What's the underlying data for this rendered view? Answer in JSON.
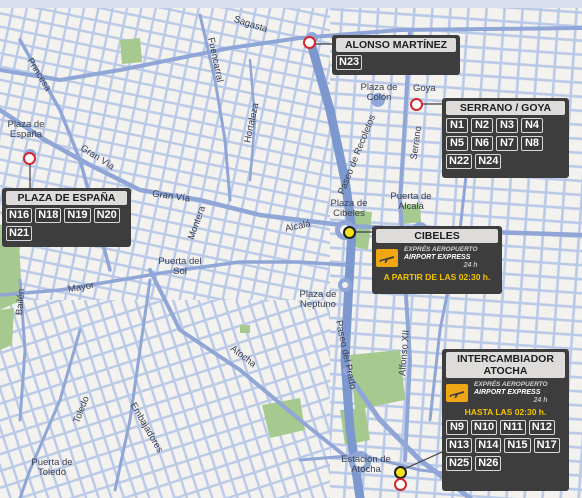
{
  "map": {
    "places": {
      "sagasta": "Sagasta",
      "goya": "Goya",
      "plaza_colon": "Plaza de Colón",
      "princesa": "Princesa",
      "fuencarral": "Fuencarral",
      "hortaleza": "Hortaleza",
      "plaza_espana": "Plaza de España",
      "gran_via_1": "Gran Vía",
      "gran_via_2": "Gran Vía",
      "paseo_recoletos": "Paseo de Recoletos",
      "serrano": "Serrano",
      "plaza_cibeles": "Plaza de Cibeles",
      "puerta_alcala": "Puerta de Alcalá",
      "alcala": "Alcalá",
      "montera": "Montera",
      "puerta_sol": "Puerta del Sol",
      "mayor": "Mayor",
      "bailen": "Bailén",
      "plaza_neptuno": "Plaza de Neptuno",
      "paseo_prado": "Paseo del Prado",
      "alfonso_xii": "Alfonso XII",
      "atocha": "Atocha",
      "toledo": "Toledo",
      "embajadores": "Embajadores",
      "puerta_toledo": "Puerta de Toledo",
      "estacion_atocha": "Estación de Atocha"
    },
    "colors": {
      "block": "#f4f2ee",
      "street_light": "#b9c9e8",
      "street_main": "#8fa6d6",
      "park": "#a5c98e",
      "stop_red": "#d3272b",
      "stop_yellow": "#f5e21a",
      "panel": "#3d3d3e",
      "accent": "#f5c400"
    }
  },
  "panels": {
    "alonso": {
      "title": "ALONSO MARTÍNEZ",
      "codes": [
        "N23"
      ]
    },
    "serrano": {
      "title": "SERRANO / GOYA",
      "codes": [
        "N1",
        "N2",
        "N3",
        "N4",
        "N5",
        "N6",
        "N7",
        "N8",
        "N22",
        "N24"
      ]
    },
    "espana": {
      "title": "PLAZA DE ESPAÑA",
      "codes": [
        "N16",
        "N18",
        "N19",
        "N20",
        "N21"
      ]
    },
    "cibeles": {
      "title": "CIBELES",
      "brand_top": "EXPRÉS AEROPUERTO",
      "brand_main": "AIRPORT EXPRESS",
      "brand_24": "24 h",
      "note": "A PARTIR DE LAS 02:30 h."
    },
    "atocha": {
      "title_1": "INTERCAMBIADOR",
      "title_2": "ATOCHA",
      "brand_top": "EXPRÉS AEROPUERTO",
      "brand_main": "AIRPORT EXPRESS",
      "brand_24": "24 h",
      "note": "HASTA LAS 02:30 h.",
      "codes": [
        "N9",
        "N10",
        "N11",
        "N12",
        "N13",
        "N14",
        "N15",
        "N17",
        "N25",
        "N26"
      ]
    }
  }
}
